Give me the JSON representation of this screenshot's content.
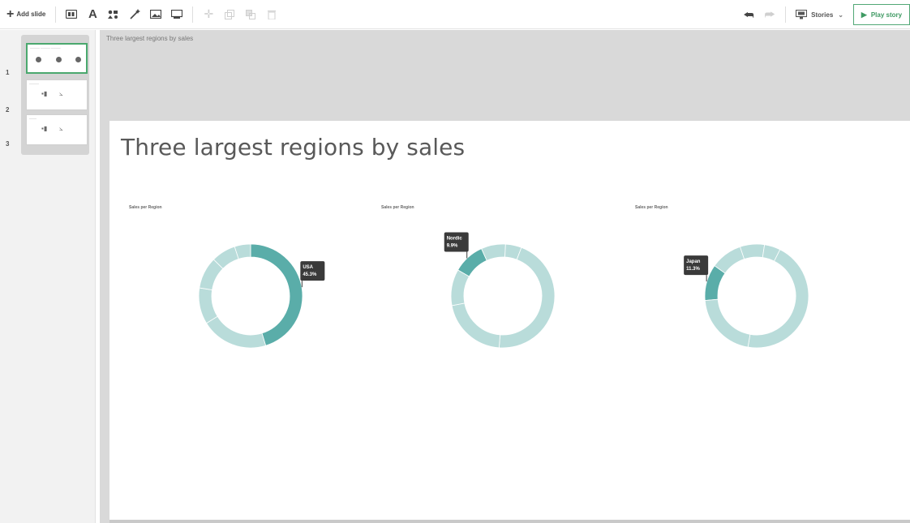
{
  "toolbar": {
    "add_slide_label": "Add slide",
    "stories_label": "Stories",
    "play_label": "Play story"
  },
  "thumbnails": [
    {
      "number": "1",
      "active": true
    },
    {
      "number": "2",
      "active": false
    },
    {
      "number": "3",
      "active": false
    }
  ],
  "story": {
    "title": "Three largest regions by sales"
  },
  "slide": {
    "title": "Three largest regions by sales"
  },
  "colors": {
    "accent": "#5aada9",
    "ring": "#b9dcda",
    "tooltip": "#3a3a3a",
    "play": "#3f9a63"
  },
  "chart_data": [
    {
      "type": "pie",
      "title": "Sales per Region",
      "highlight": {
        "label": "USA",
        "value_text": "45.3%",
        "value": 45.3
      },
      "slices": [
        45.3,
        20.9,
        11.3,
        9.9,
        7.6,
        5.0
      ]
    },
    {
      "type": "pie",
      "title": "Sales per Region",
      "highlight": {
        "label": "Nordic",
        "value_text": "9.9%",
        "value": 9.9
      },
      "slices": [
        45.3,
        20.9,
        11.3,
        9.9,
        7.6,
        5.0
      ]
    },
    {
      "type": "pie",
      "title": "Sales per Region",
      "highlight": {
        "label": "Japan",
        "value_text": "11.3%",
        "value": 11.3
      },
      "slices": [
        45.3,
        20.9,
        11.3,
        9.9,
        7.6,
        5.0
      ]
    }
  ]
}
